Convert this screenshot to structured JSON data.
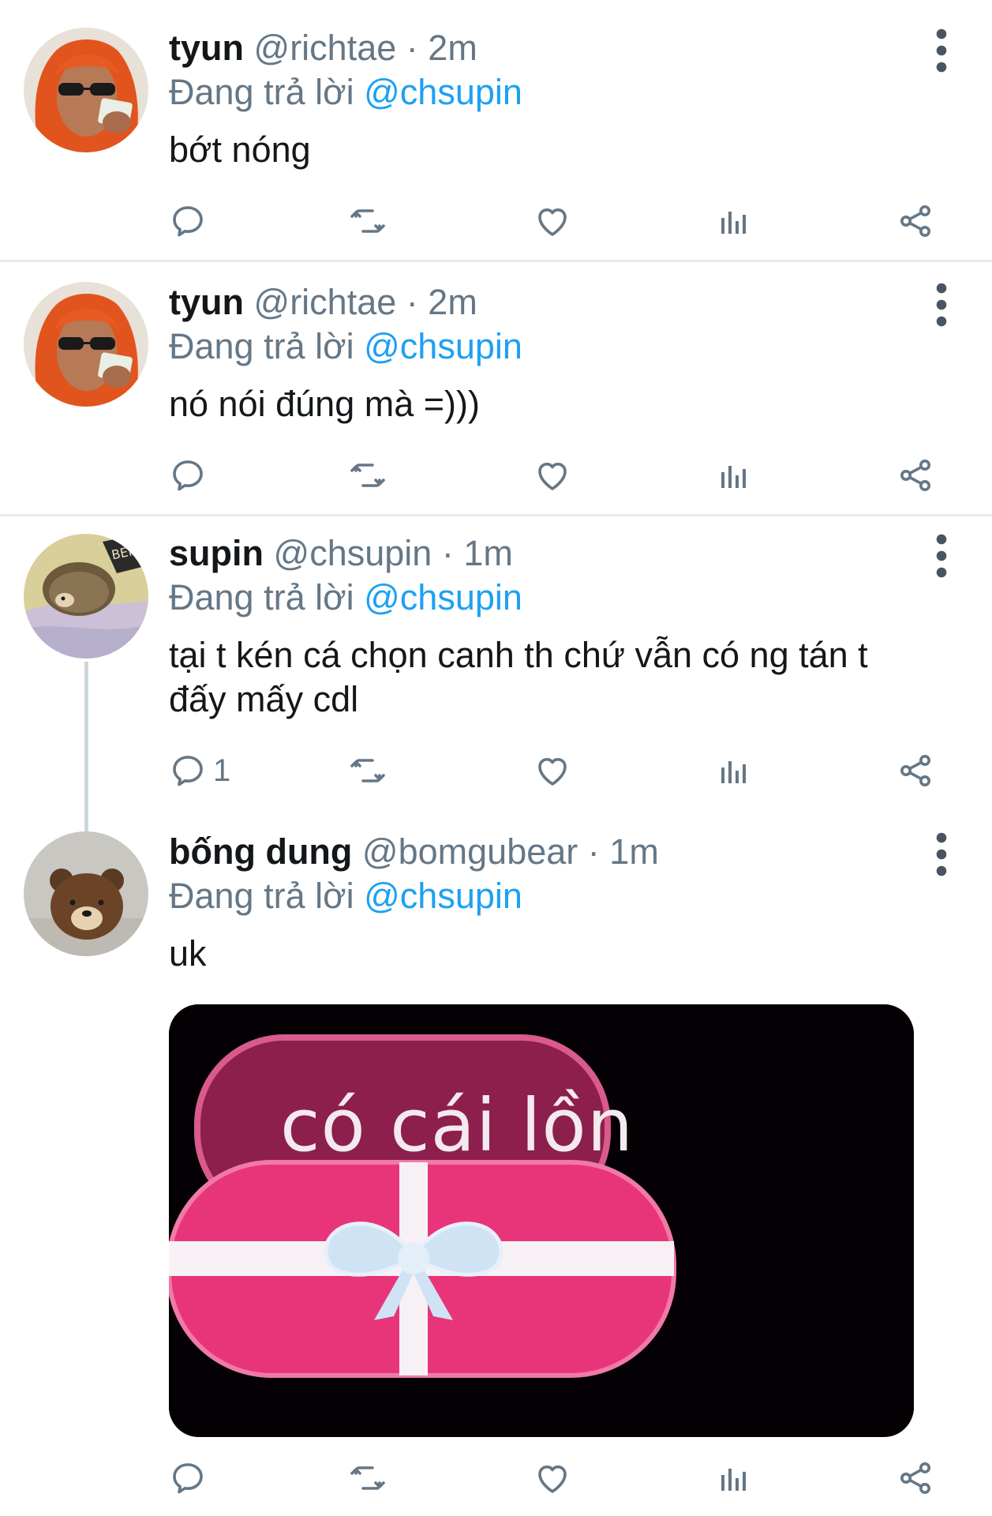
{
  "reply_prefix": "Đang trả lời",
  "tweets": [
    {
      "name": "tyun",
      "handle": "@richtae",
      "separator": "·",
      "time": "2m",
      "reply_to": "@chsupin",
      "text": "bớt nóng",
      "reply_count": ""
    },
    {
      "name": "tyun",
      "handle": "@richtae",
      "separator": "·",
      "time": "2m",
      "reply_to": "@chsupin",
      "text": "nó nói đúng mà =)))",
      "reply_count": ""
    },
    {
      "name": "supin",
      "handle": "@chsupin",
      "separator": "·",
      "time": "1m",
      "reply_to": "@chsupin",
      "text": "tại t kén cá chọn canh th chứ vẫn có ng tán t đấy mấy cdl",
      "reply_count": "1"
    },
    {
      "name": "bống dung",
      "handle": "@bomgubear",
      "separator": "·",
      "time": "1m",
      "reply_to": "@chsupin",
      "text": "uk",
      "reply_count": "",
      "media_text": "có cái lồn"
    }
  ],
  "colors": {
    "link": "#1da1f2",
    "secondary_text": "#657786",
    "divider": "#e6ecf0",
    "icon": "#657786"
  },
  "icons": {
    "reply": "reply-icon",
    "retweet": "retweet-icon",
    "like": "heart-icon",
    "analytics": "analytics-icon",
    "share": "share-icon",
    "more": "more-vertical-icon"
  }
}
